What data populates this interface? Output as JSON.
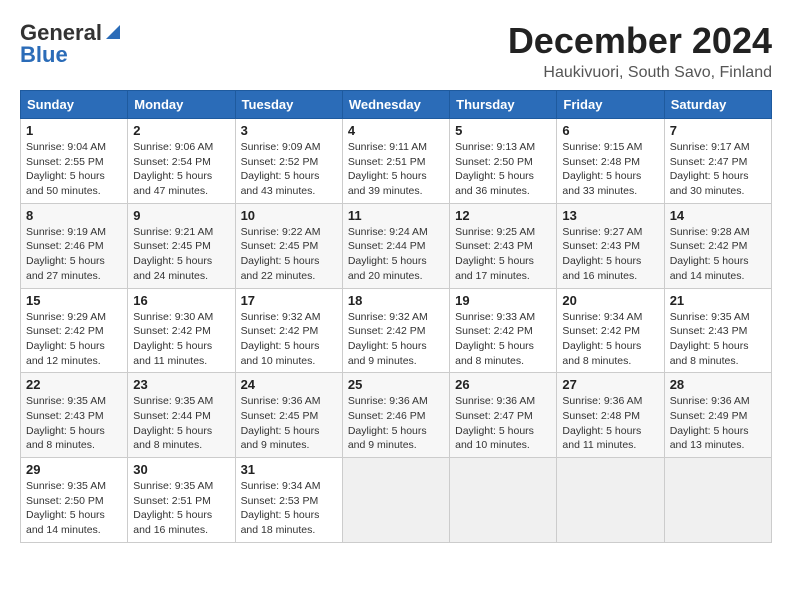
{
  "logo": {
    "line1": "General",
    "line2": "Blue"
  },
  "header": {
    "title": "December 2024",
    "subtitle": "Haukivuori, South Savo, Finland"
  },
  "weekdays": [
    "Sunday",
    "Monday",
    "Tuesday",
    "Wednesday",
    "Thursday",
    "Friday",
    "Saturday"
  ],
  "weeks": [
    [
      {
        "day": "1",
        "info": "Sunrise: 9:04 AM\nSunset: 2:55 PM\nDaylight: 5 hours\nand 50 minutes."
      },
      {
        "day": "2",
        "info": "Sunrise: 9:06 AM\nSunset: 2:54 PM\nDaylight: 5 hours\nand 47 minutes."
      },
      {
        "day": "3",
        "info": "Sunrise: 9:09 AM\nSunset: 2:52 PM\nDaylight: 5 hours\nand 43 minutes."
      },
      {
        "day": "4",
        "info": "Sunrise: 9:11 AM\nSunset: 2:51 PM\nDaylight: 5 hours\nand 39 minutes."
      },
      {
        "day": "5",
        "info": "Sunrise: 9:13 AM\nSunset: 2:50 PM\nDaylight: 5 hours\nand 36 minutes."
      },
      {
        "day": "6",
        "info": "Sunrise: 9:15 AM\nSunset: 2:48 PM\nDaylight: 5 hours\nand 33 minutes."
      },
      {
        "day": "7",
        "info": "Sunrise: 9:17 AM\nSunset: 2:47 PM\nDaylight: 5 hours\nand 30 minutes."
      }
    ],
    [
      {
        "day": "8",
        "info": "Sunrise: 9:19 AM\nSunset: 2:46 PM\nDaylight: 5 hours\nand 27 minutes."
      },
      {
        "day": "9",
        "info": "Sunrise: 9:21 AM\nSunset: 2:45 PM\nDaylight: 5 hours\nand 24 minutes."
      },
      {
        "day": "10",
        "info": "Sunrise: 9:22 AM\nSunset: 2:45 PM\nDaylight: 5 hours\nand 22 minutes."
      },
      {
        "day": "11",
        "info": "Sunrise: 9:24 AM\nSunset: 2:44 PM\nDaylight: 5 hours\nand 20 minutes."
      },
      {
        "day": "12",
        "info": "Sunrise: 9:25 AM\nSunset: 2:43 PM\nDaylight: 5 hours\nand 17 minutes."
      },
      {
        "day": "13",
        "info": "Sunrise: 9:27 AM\nSunset: 2:43 PM\nDaylight: 5 hours\nand 16 minutes."
      },
      {
        "day": "14",
        "info": "Sunrise: 9:28 AM\nSunset: 2:42 PM\nDaylight: 5 hours\nand 14 minutes."
      }
    ],
    [
      {
        "day": "15",
        "info": "Sunrise: 9:29 AM\nSunset: 2:42 PM\nDaylight: 5 hours\nand 12 minutes."
      },
      {
        "day": "16",
        "info": "Sunrise: 9:30 AM\nSunset: 2:42 PM\nDaylight: 5 hours\nand 11 minutes."
      },
      {
        "day": "17",
        "info": "Sunrise: 9:32 AM\nSunset: 2:42 PM\nDaylight: 5 hours\nand 10 minutes."
      },
      {
        "day": "18",
        "info": "Sunrise: 9:32 AM\nSunset: 2:42 PM\nDaylight: 5 hours\nand 9 minutes."
      },
      {
        "day": "19",
        "info": "Sunrise: 9:33 AM\nSunset: 2:42 PM\nDaylight: 5 hours\nand 8 minutes."
      },
      {
        "day": "20",
        "info": "Sunrise: 9:34 AM\nSunset: 2:42 PM\nDaylight: 5 hours\nand 8 minutes."
      },
      {
        "day": "21",
        "info": "Sunrise: 9:35 AM\nSunset: 2:43 PM\nDaylight: 5 hours\nand 8 minutes."
      }
    ],
    [
      {
        "day": "22",
        "info": "Sunrise: 9:35 AM\nSunset: 2:43 PM\nDaylight: 5 hours\nand 8 minutes."
      },
      {
        "day": "23",
        "info": "Sunrise: 9:35 AM\nSunset: 2:44 PM\nDaylight: 5 hours\nand 8 minutes."
      },
      {
        "day": "24",
        "info": "Sunrise: 9:36 AM\nSunset: 2:45 PM\nDaylight: 5 hours\nand 9 minutes."
      },
      {
        "day": "25",
        "info": "Sunrise: 9:36 AM\nSunset: 2:46 PM\nDaylight: 5 hours\nand 9 minutes."
      },
      {
        "day": "26",
        "info": "Sunrise: 9:36 AM\nSunset: 2:47 PM\nDaylight: 5 hours\nand 10 minutes."
      },
      {
        "day": "27",
        "info": "Sunrise: 9:36 AM\nSunset: 2:48 PM\nDaylight: 5 hours\nand 11 minutes."
      },
      {
        "day": "28",
        "info": "Sunrise: 9:36 AM\nSunset: 2:49 PM\nDaylight: 5 hours\nand 13 minutes."
      }
    ],
    [
      {
        "day": "29",
        "info": "Sunrise: 9:35 AM\nSunset: 2:50 PM\nDaylight: 5 hours\nand 14 minutes."
      },
      {
        "day": "30",
        "info": "Sunrise: 9:35 AM\nSunset: 2:51 PM\nDaylight: 5 hours\nand 16 minutes."
      },
      {
        "day": "31",
        "info": "Sunrise: 9:34 AM\nSunset: 2:53 PM\nDaylight: 5 hours\nand 18 minutes."
      },
      {
        "day": "",
        "info": ""
      },
      {
        "day": "",
        "info": ""
      },
      {
        "day": "",
        "info": ""
      },
      {
        "day": "",
        "info": ""
      }
    ]
  ]
}
